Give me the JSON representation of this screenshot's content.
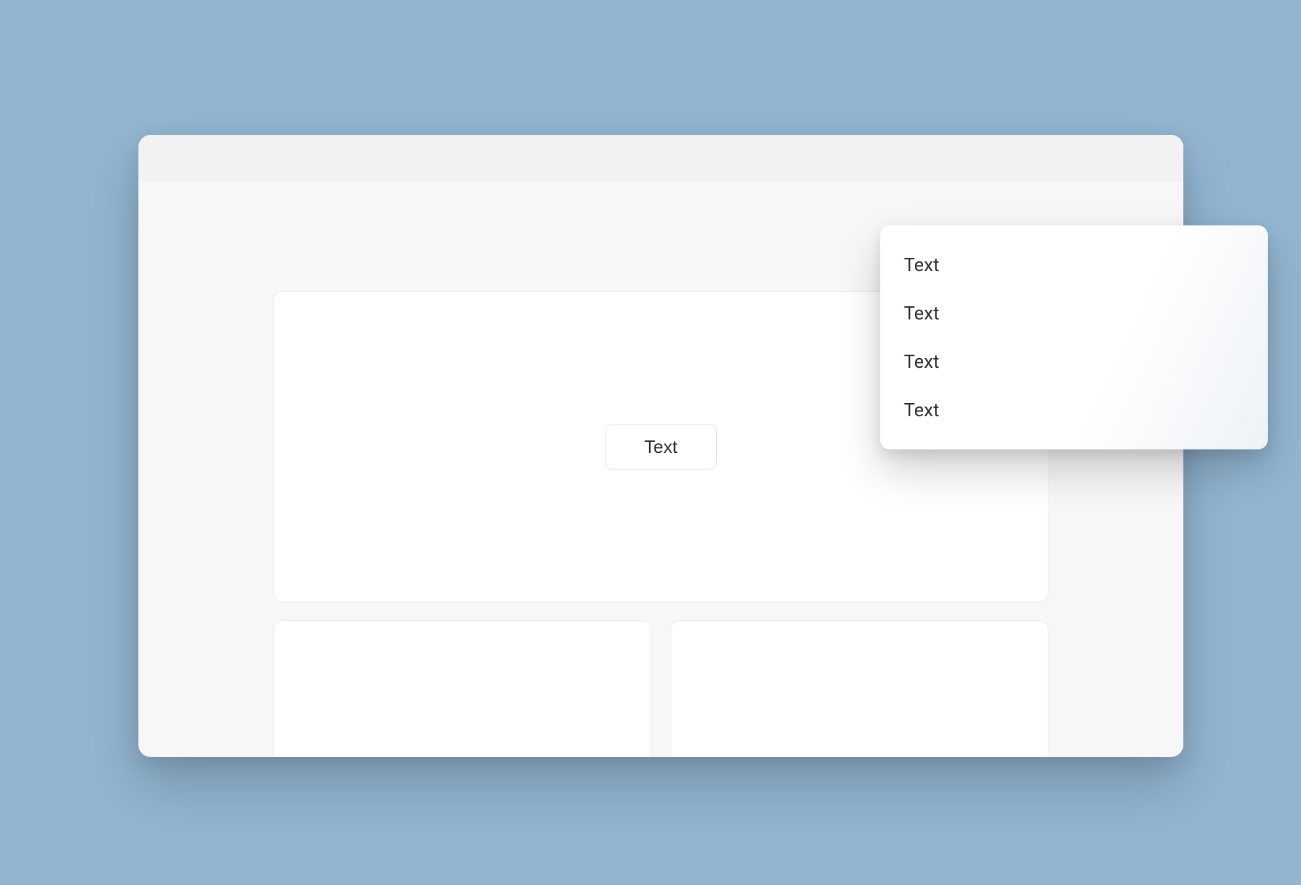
{
  "main": {
    "button_label": "Text"
  },
  "dropdown": {
    "items": [
      {
        "label": "Text"
      },
      {
        "label": "Text"
      },
      {
        "label": "Text"
      },
      {
        "label": "Text"
      }
    ]
  }
}
